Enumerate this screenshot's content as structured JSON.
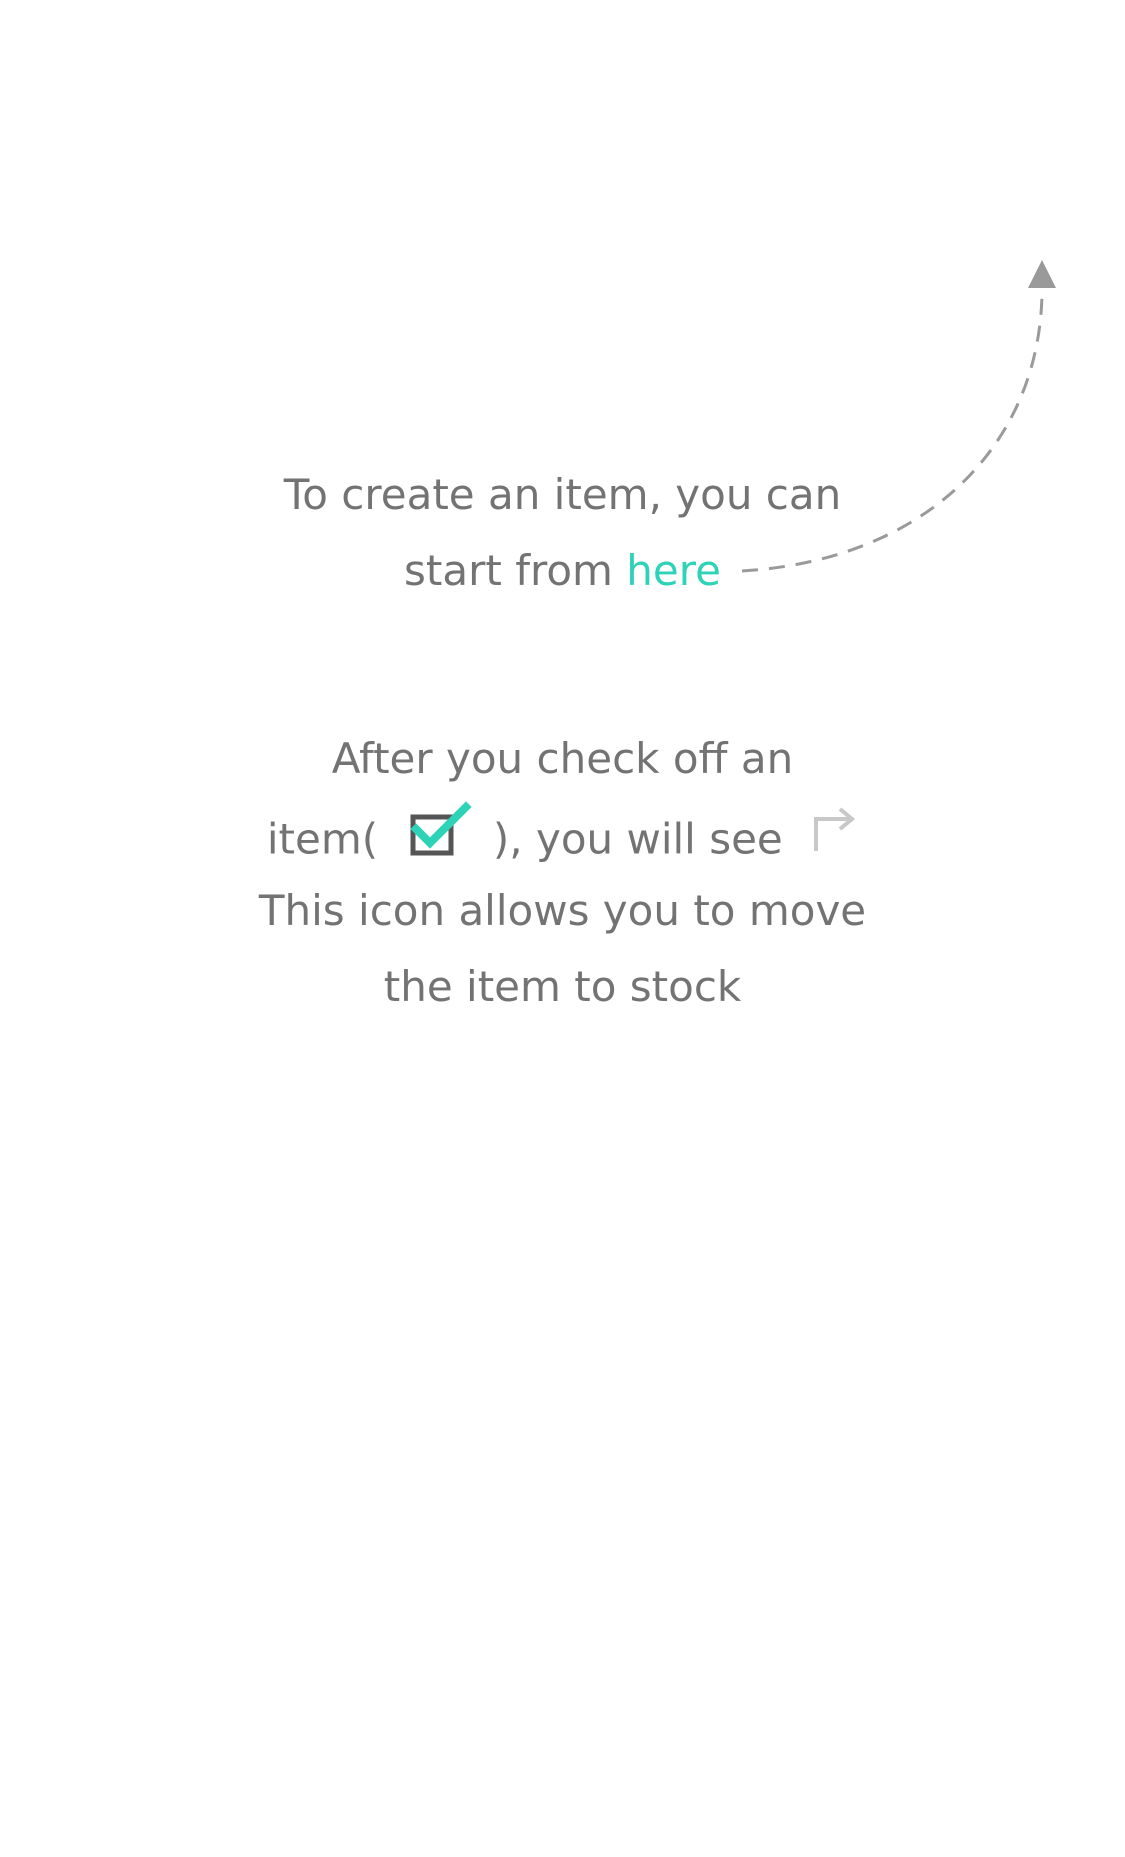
{
  "hint_create": {
    "line1": "To create an item, you can",
    "line2_prefix": "start from ",
    "line2_link": "here"
  },
  "hint_check": {
    "line1": "After you check off an",
    "line2_prefix": "item(",
    "line2_suffix": "), you will see",
    "line3": "This icon allows you to move",
    "line4": "the item to stock"
  },
  "icons": {
    "checkbox": "checked-checkbox-icon",
    "move": "move-to-stock-arrow-icon",
    "pointer": "dashed-arrow-pointer-icon"
  },
  "colors": {
    "text": "#737373",
    "accent": "#2ed3b7",
    "arrow": "#9a9a9a",
    "move_icon": "#c8c8c8",
    "checkbox_border": "#555555"
  }
}
